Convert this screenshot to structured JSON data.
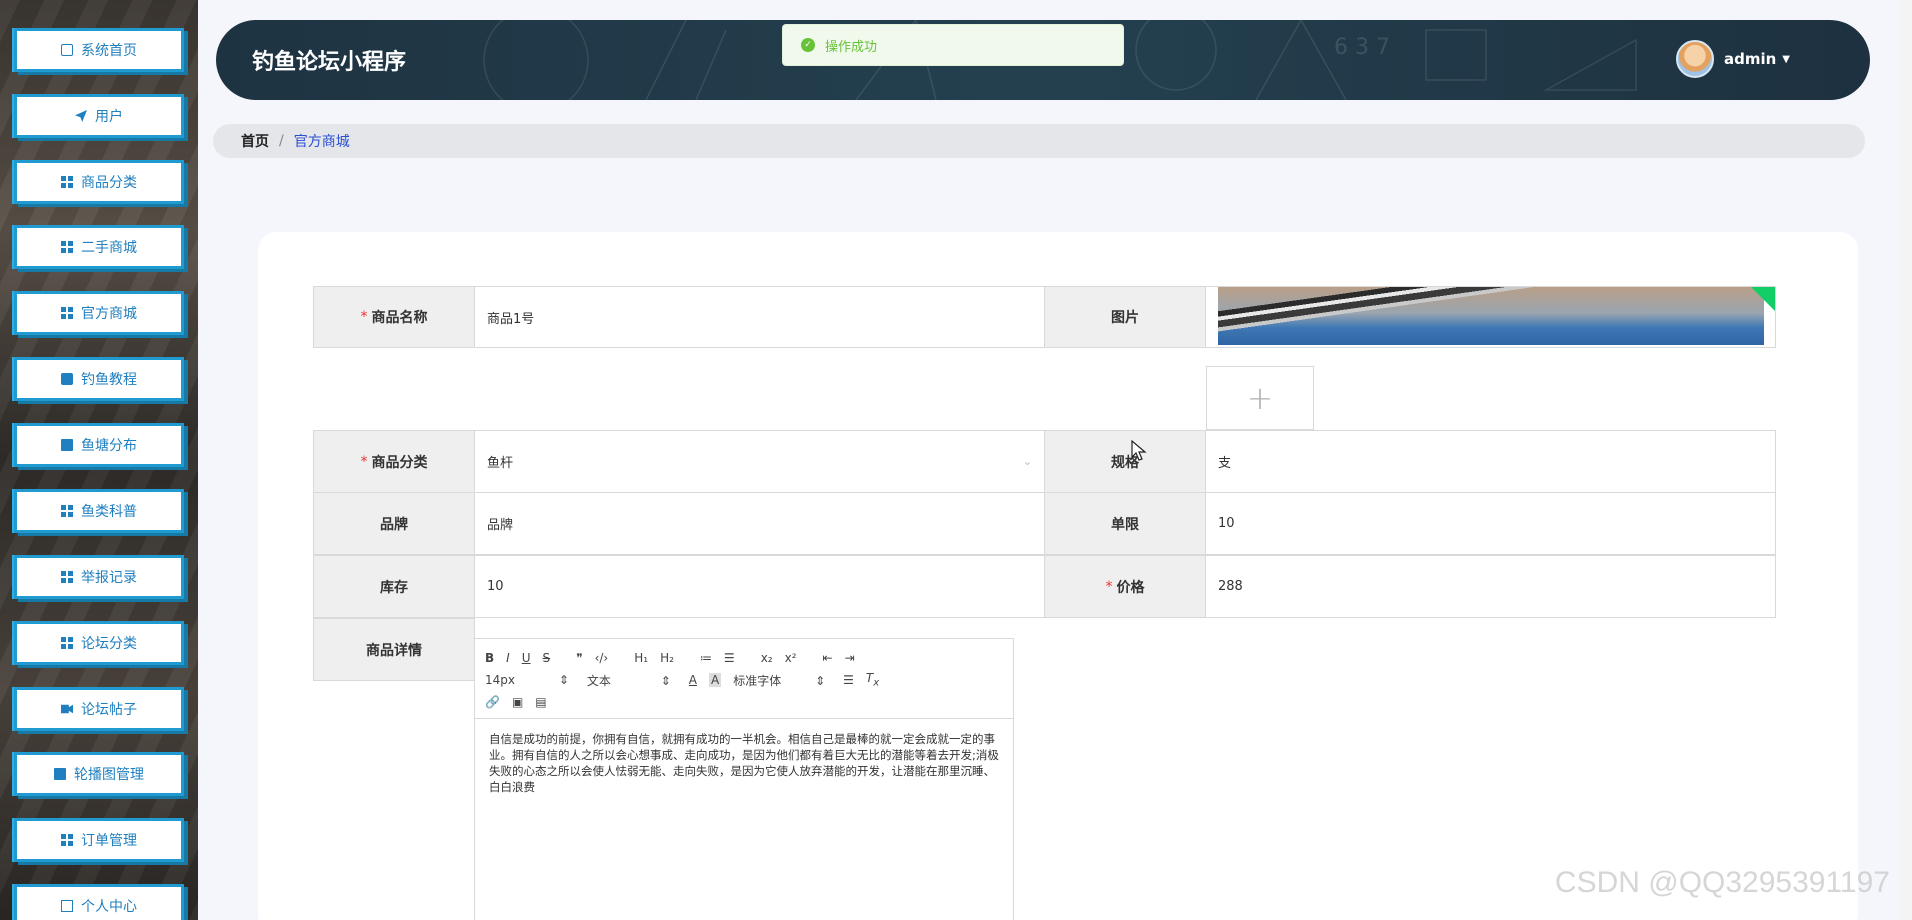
{
  "sidebar": {
    "items": [
      {
        "label": "系统首页",
        "icon": "home-icon"
      },
      {
        "label": "用户",
        "icon": "send-icon"
      },
      {
        "label": "商品分类",
        "icon": "grid-icon"
      },
      {
        "label": "二手商城",
        "icon": "grid-icon"
      },
      {
        "label": "官方商城",
        "icon": "grid-icon"
      },
      {
        "label": "钓鱼教程",
        "icon": "clipboard-icon"
      },
      {
        "label": "鱼塘分布",
        "icon": "monitor-icon"
      },
      {
        "label": "鱼类科普",
        "icon": "grid-icon"
      },
      {
        "label": "举报记录",
        "icon": "grid-icon"
      },
      {
        "label": "论坛分类",
        "icon": "grid-icon"
      },
      {
        "label": "论坛帖子",
        "icon": "video-icon"
      },
      {
        "label": "轮播图管理",
        "icon": "monitor-icon"
      },
      {
        "label": "订单管理",
        "icon": "grid-icon"
      },
      {
        "label": "个人中心",
        "icon": "user-card-icon"
      }
    ]
  },
  "header": {
    "title": "钓鱼论坛小程序",
    "username": "admin"
  },
  "toast": {
    "message": "操作成功"
  },
  "breadcrumb": {
    "home": "首页",
    "separator": "/",
    "current": "官方商城"
  },
  "form": {
    "name_label": "商品名称",
    "name_value": "商品1号",
    "image_label": "图片",
    "category_label": "商品分类",
    "category_value": "鱼杆",
    "spec_label": "规格",
    "spec_value": "支",
    "brand_label": "品牌",
    "brand_value": "品牌",
    "limit_label": "单限",
    "limit_value": "10",
    "stock_label": "库存",
    "stock_value": "10",
    "price_label": "价格",
    "price_value": "288",
    "detail_label": "商品详情",
    "required_mark": "*"
  },
  "editor": {
    "toolbar_row1": [
      "B",
      "I",
      "U",
      "S",
      "❞",
      "‹/›",
      "H₁",
      "H₂",
      "≔",
      "☰",
      "x₂",
      "x²",
      "⇤",
      "⇥"
    ],
    "font_size": "14px",
    "block_type": "文本",
    "font_family": "标准字体",
    "content": "自信是成功的前提，你拥有自信，就拥有成功的一半机会。相信自己是最棒的就一定会成就一定的事业。拥有自信的人之所以会心想事成、走向成功，是因为他们都有着巨大无比的潜能等着去开发;消极失败的心态之所以会使人怯弱无能、走向失败，是因为它使人放弃潜能的开发，让潜能在那里沉睡、白白浪费"
  },
  "watermark": "CSDN @QQ3295391197",
  "colors": {
    "accent": "#1f9bd1",
    "header_bg": "#1e3342",
    "success": "#67c23a",
    "required": "#e33333"
  }
}
